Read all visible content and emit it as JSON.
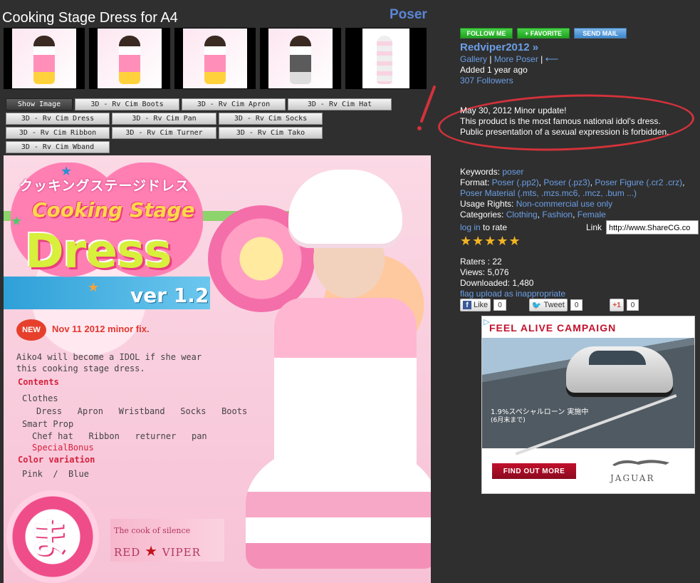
{
  "page": {
    "title": "Cooking Stage Dress for A4",
    "category": "Poser"
  },
  "thumbnails": [
    {
      "name": "thumb-1"
    },
    {
      "name": "thumb-2"
    },
    {
      "name": "thumb-3"
    },
    {
      "name": "thumb-4"
    },
    {
      "name": "thumb-5"
    }
  ],
  "tabs": {
    "row1": [
      "Show Image",
      "3D - Rv Cim Boots",
      "3D - Rv Cim Apron",
      "3D - Rv Cim Hat"
    ],
    "row2": [
      "3D - Rv Cim Dress",
      "3D - Rv Cim Pan",
      "3D - Rv Cim Socks"
    ],
    "row3": [
      "3D - Rv Cim Ribbon",
      "3D - Rv Cim Turner",
      "3D - Rv Cim Tako"
    ],
    "row4": [
      "3D - Rv Cim Wband"
    ]
  },
  "main_image": {
    "logo_jp": "クッキングステージドレス",
    "logo_cooking": "Cooking Stage",
    "logo_dress": "Dress",
    "version": "ver 1.2",
    "new_badge": "NEW",
    "fix_note": "Nov 11 2012 minor fix.",
    "intro_1": "Aiko4 will become a IDOL if she wear",
    "intro_2": "this cooking stage dress.",
    "contents": "Contents",
    "clothes": "Clothes",
    "clothes_items": "Dress   Apron   Wristband   Socks   Boots",
    "smart_prop": "Smart Prop",
    "prop_items": "Chef hat   Ribbon   returner   pan",
    "special": "SpecialBonus",
    "color_var": "Color variation",
    "colors": "Pink  /  Blue",
    "badge_char": "ま",
    "silence": "The cook of silence",
    "red": "RED",
    "viper": "VIPER"
  },
  "sidebar": {
    "follow_btn": "FOLLOW ME",
    "favorite_btn": "+ FAVORITE",
    "mail_btn": "SEND MAIL",
    "username": "Redviper2012 »",
    "gallery": "Gallery",
    "more": "More Poser",
    "sep": " | ",
    "added": "Added 1 year ago",
    "followers": "307 Followers"
  },
  "notes": {
    "line1": "May 30, 2012 Minor update!",
    "line2": "This product is the most famous national idol's dress.",
    "line3": "Public presentation of a sexual expression is forbidden."
  },
  "meta": {
    "keywords_label": "Keywords: ",
    "keywords": "poser",
    "format_label": "Format: ",
    "formats": [
      "Poser (.pp2)",
      "Poser (.pz3)",
      "Poser Figure (.cr2 .crz)",
      "Poser Material (.mts, .mzs.mc6, .mcz, .bum ...)"
    ],
    "usage_label": "Usage Rights: ",
    "usage": "Non-commercial use only",
    "categories_label": "Categories: ",
    "categories": [
      "Clothing",
      "Fashion",
      "Female"
    ],
    "login": "log in",
    "to_rate": " to rate",
    "link_label": "Link",
    "link_value": "http://www.ShareCG.co",
    "stars": "★★★★★",
    "rating": 5
  },
  "stats": {
    "raters": "Raters : 22",
    "views": "Views: 5,076",
    "downloaded": "Downloaded: 1,480",
    "flag": "flag upload as inappropriate"
  },
  "share": {
    "like": "Like",
    "like_count": "0",
    "tweet": "Tweet",
    "tweet_count": "0",
    "gplus": "+1",
    "gplus_count": "0"
  },
  "ad": {
    "title": "FEEL ALIVE CAMPAIGN",
    "jp1": "1.9%スペシャルローン 実施中",
    "jp2": "(6月末まで)",
    "cta": "FIND OUT MORE",
    "brand": "JAGUAR",
    "mark": "▷"
  },
  "colors": {
    "link": "#6b9fe6",
    "annotation": "#d3323a",
    "follow": "#1ea31e",
    "mail": "#3c86cc"
  }
}
